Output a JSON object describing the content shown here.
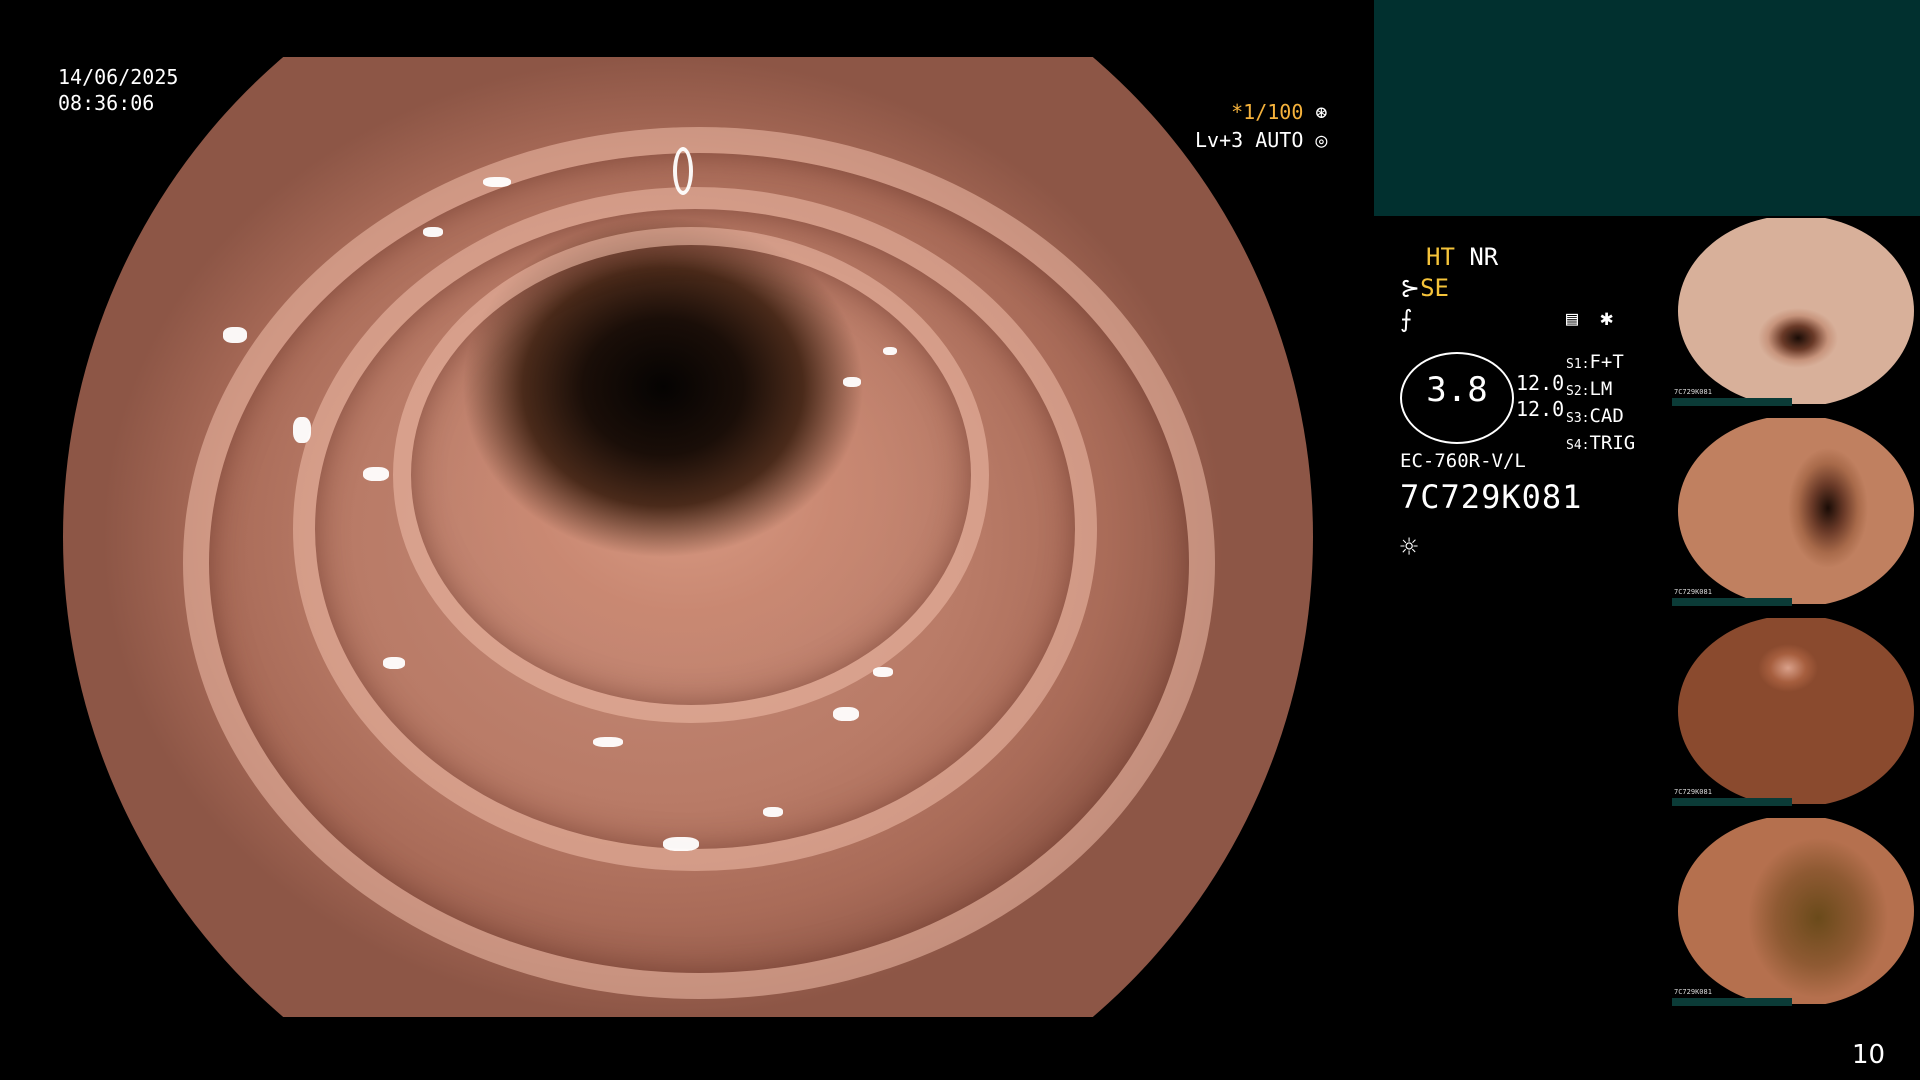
{
  "timestamp": {
    "date": "14/06/2025",
    "time": "08:36:06"
  },
  "zoom": {
    "shutter": "*1/100",
    "level": "Lv+3 AUTO"
  },
  "settings": {
    "ht": "HT",
    "nr": "NR",
    "se": "SE"
  },
  "gauge": {
    "value": "3.8",
    "left": "12.0",
    "right": "12.0"
  },
  "modes": [
    "F+T",
    "LM",
    "CAD",
    "TRIG"
  ],
  "mode_prefixes": [
    "S1:",
    "S2:",
    "S3:",
    "S4:"
  ],
  "scope": {
    "model": "EC-760R-V/L",
    "serial": "7C729K081"
  },
  "thumbnails": [
    {
      "label": "7C729K081",
      "tone": "#c7947c"
    },
    {
      "label": "7C729K081",
      "tone": "#a86a4a"
    },
    {
      "label": "7C729K081",
      "tone": "#a65e3e"
    },
    {
      "label": "7C729K081",
      "tone": "#8f5a33"
    }
  ],
  "page_number": "10",
  "icons": {
    "shutter": "aperture-icon",
    "auto": "auto-icon",
    "light": "light-icon",
    "capture": "capture-icon",
    "marker": "star-icon"
  }
}
